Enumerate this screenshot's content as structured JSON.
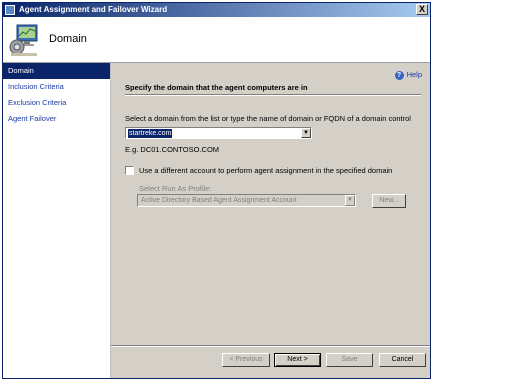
{
  "window": {
    "title": "Agent Assignment and Failover Wizard",
    "close_glyph": "X"
  },
  "header": {
    "title": "Domain"
  },
  "sidebar": {
    "items": [
      {
        "label": "Domain",
        "active": true
      },
      {
        "label": "Inclusion Criteria",
        "active": false
      },
      {
        "label": "Exclusion Criteria",
        "active": false
      },
      {
        "label": "Agent Failover",
        "active": false
      }
    ]
  },
  "main": {
    "help_label": "Help",
    "help_glyph": "?",
    "heading": "Specify the domain that the agent computers are in",
    "instruction": "Select a domain from the list or type the name of domain or FQDN of a domain control",
    "domain_value": "startreke.com",
    "example": "E.g. DC01.CONTOSO.COM",
    "checkbox_label": "Use a different account to perform agent assignment in the specified domain",
    "checkbox_checked": false,
    "runas_label": "Select Run As Profile:",
    "runas_value": "Active Directory Based Agent Assignment Account",
    "new_button": "New..."
  },
  "buttons": {
    "previous": "< Previous",
    "next": "Next >",
    "save": "Save",
    "cancel": "Cancel"
  },
  "colors": {
    "title_bar": "#0a246a",
    "selection": "#0a246a",
    "link": "#1b3aa8"
  },
  "icons": {
    "header": "monitor-gear-icon",
    "dropdown": "chevron-down-icon"
  }
}
